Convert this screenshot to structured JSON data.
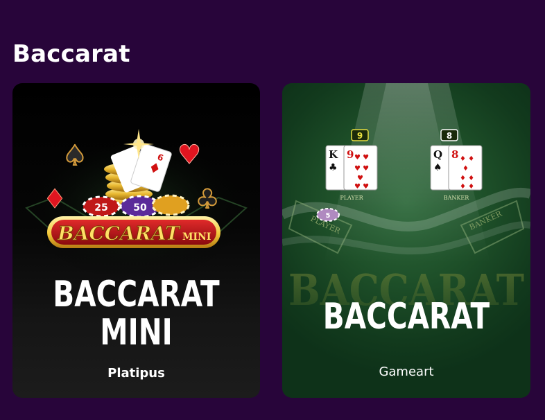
{
  "section": {
    "title": "Baccarat"
  },
  "games": [
    {
      "title_lines": [
        "BACCARAT",
        "MINI"
      ],
      "provider": "Platipus",
      "logo_text": {
        "main": "BACCARAT",
        "sub": "MINI"
      },
      "chip_values": [
        "25",
        "50"
      ]
    },
    {
      "title": "BACCARAT",
      "provider": "Gameart",
      "scores": {
        "player": "9",
        "banker": "8"
      },
      "labels": {
        "player": "PLAYER",
        "banker": "BANKER"
      },
      "player_cards": [
        "K",
        "9"
      ],
      "banker_cards": [
        "Q",
        "8"
      ],
      "chip_value": "5",
      "watermark": "BACCARAT"
    }
  ],
  "colors": {
    "background": "#28053a",
    "card1_bg": "#0b0b0b",
    "card2_bg": "#1c4e27",
    "logo_red": "#c8141a",
    "logo_gold": "#f2c83a"
  }
}
